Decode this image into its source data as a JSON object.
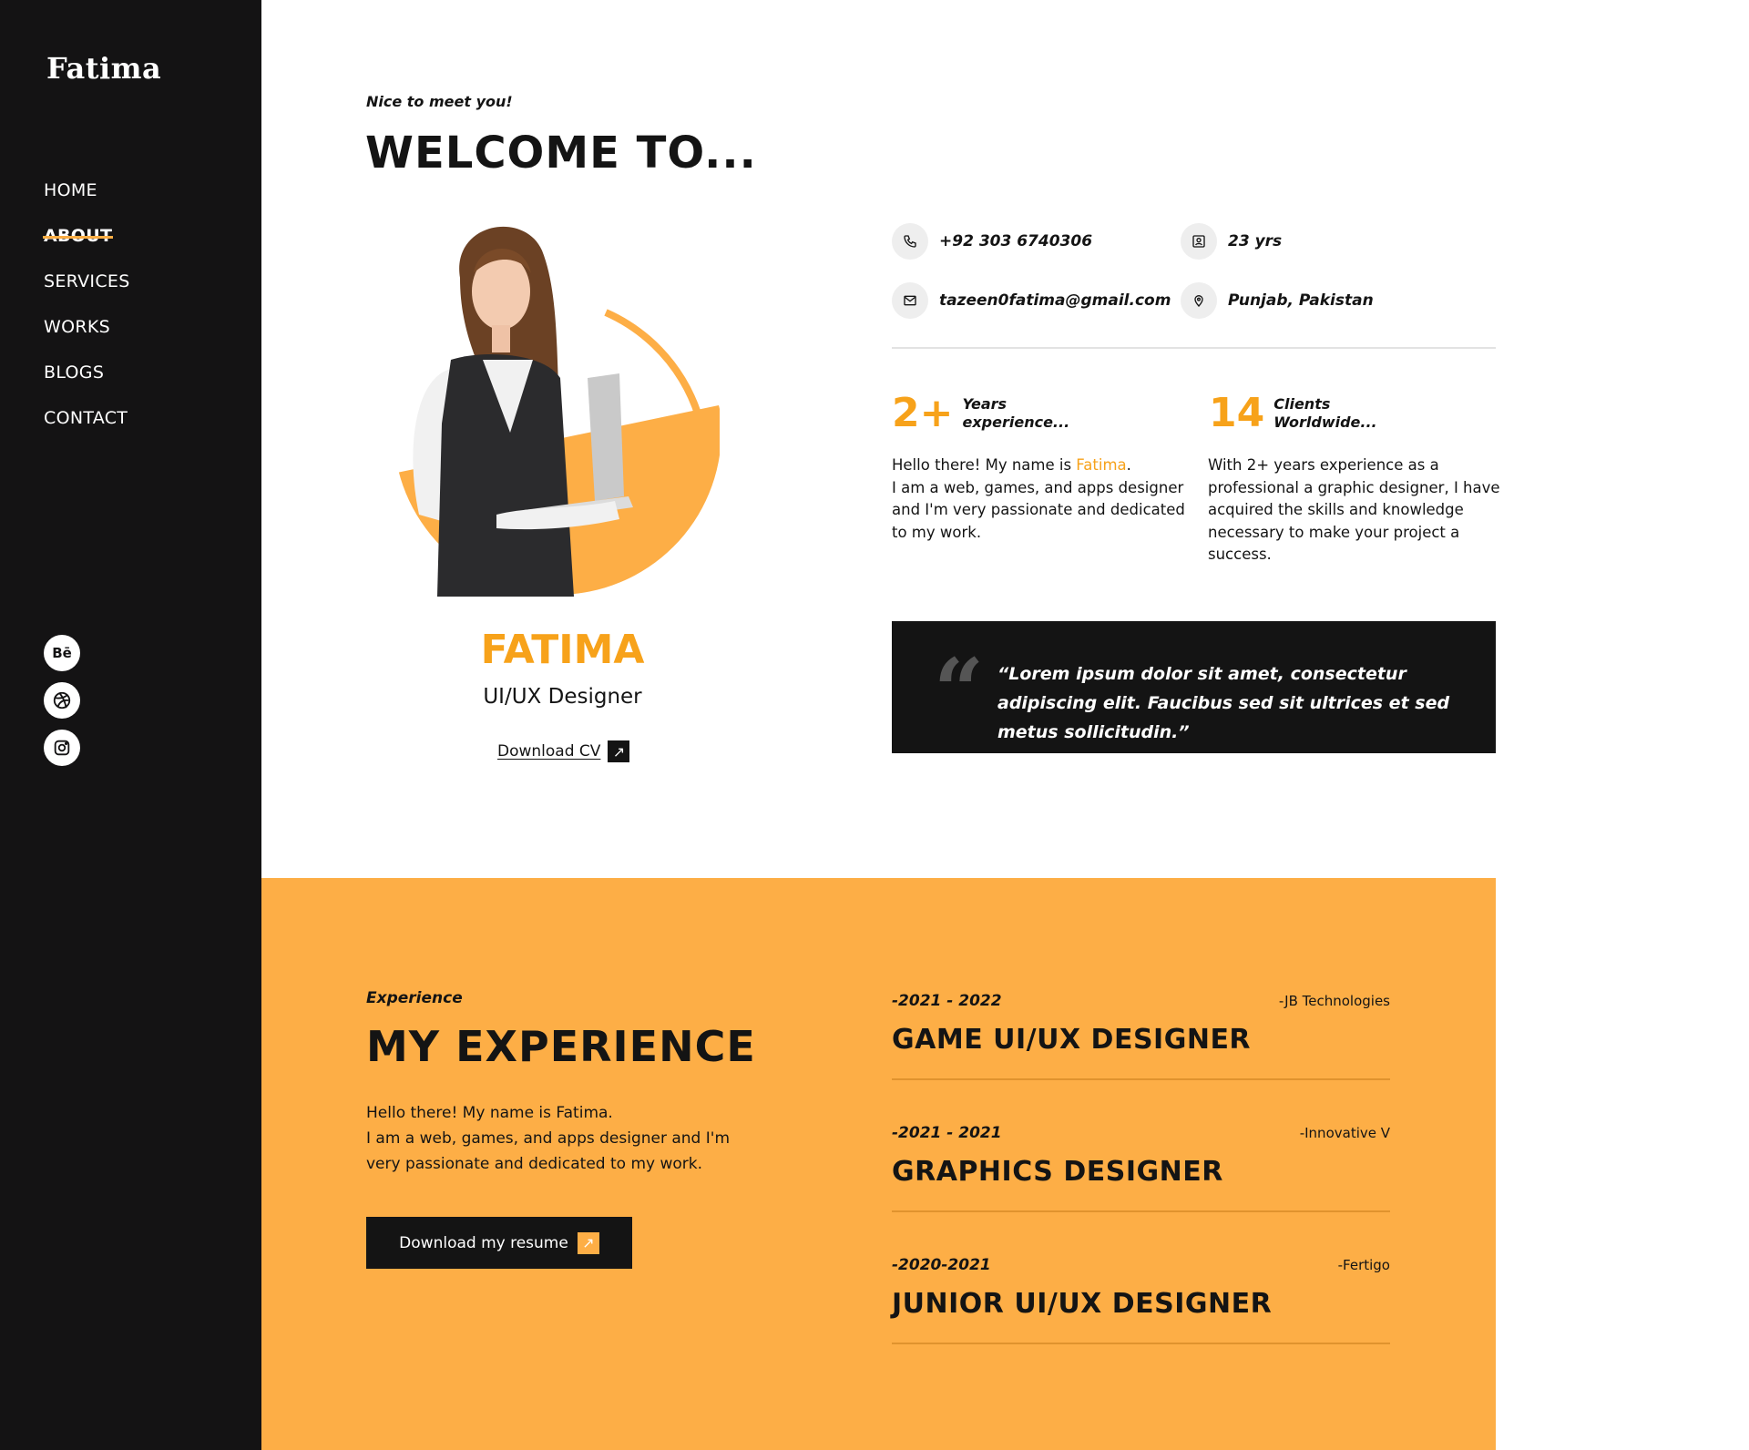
{
  "brand": "Fatima",
  "nav": {
    "items": [
      "HOME",
      "ABOUT",
      "SERVICES",
      "WORKS",
      "BLOGS",
      "CONTACT"
    ],
    "active": "ABOUT"
  },
  "socials": [
    "behance-icon",
    "dribbble-icon",
    "instagram-icon"
  ],
  "socials_text": {
    "behance": "Bē"
  },
  "hero": {
    "eyebrow": "Nice to meet you!",
    "heading": "WELCOME TO...",
    "name": "FATIMA",
    "role": "UI/UX Designer",
    "download_cv": "Download CV"
  },
  "info": {
    "phone": "+92 303 6740306",
    "age": "23 yrs",
    "email": "tazeen0fatima@gmail.com",
    "location": "Punjab, Pakistan"
  },
  "stats": [
    {
      "number": "2+",
      "label_line1": "Years",
      "label_line2": "experience..."
    },
    {
      "number": "14",
      "label_line1": "Clients",
      "label_line2": "Worldwide..."
    }
  ],
  "bio_left": {
    "prefix": "Hello there! My name is ",
    "name": "Fatima",
    "suffix": ".",
    "body": "I am a web, games, and apps designer and I'm very passionate and dedicated to my work."
  },
  "bio_right": "With 2+ years experience as a professional a graphic designer, I have acquired the skills and knowledge necessary to make your project a success.",
  "quote": "“Lorem ipsum dolor sit amet, consectetur adipiscing elit. Faucibus sed sit ultrices et sed metus sollicitudin.”",
  "experience": {
    "eyebrow": "Experience",
    "heading": "MY EXPERIENCE",
    "line1": "Hello there! My name is Fatima.",
    "line2": "I am a web, games, and apps designer and I'm very passionate and dedicated to my work.",
    "button": "Download my resume",
    "jobs": [
      {
        "period": "-2021 - 2022",
        "company": "-JB Technologies",
        "title": "GAME UI/UX DESIGNER"
      },
      {
        "period": "-2021 - 2021",
        "company": "-Innovative V",
        "title": "GRAPHICS DESIGNER"
      },
      {
        "period": "-2020-2021",
        "company": "-Fertigo",
        "title": "JUNIOR UI/UX DESIGNER"
      }
    ]
  },
  "colors": {
    "accent": "#fdae46",
    "accent_text": "#f7a21a",
    "dark": "#141314"
  }
}
